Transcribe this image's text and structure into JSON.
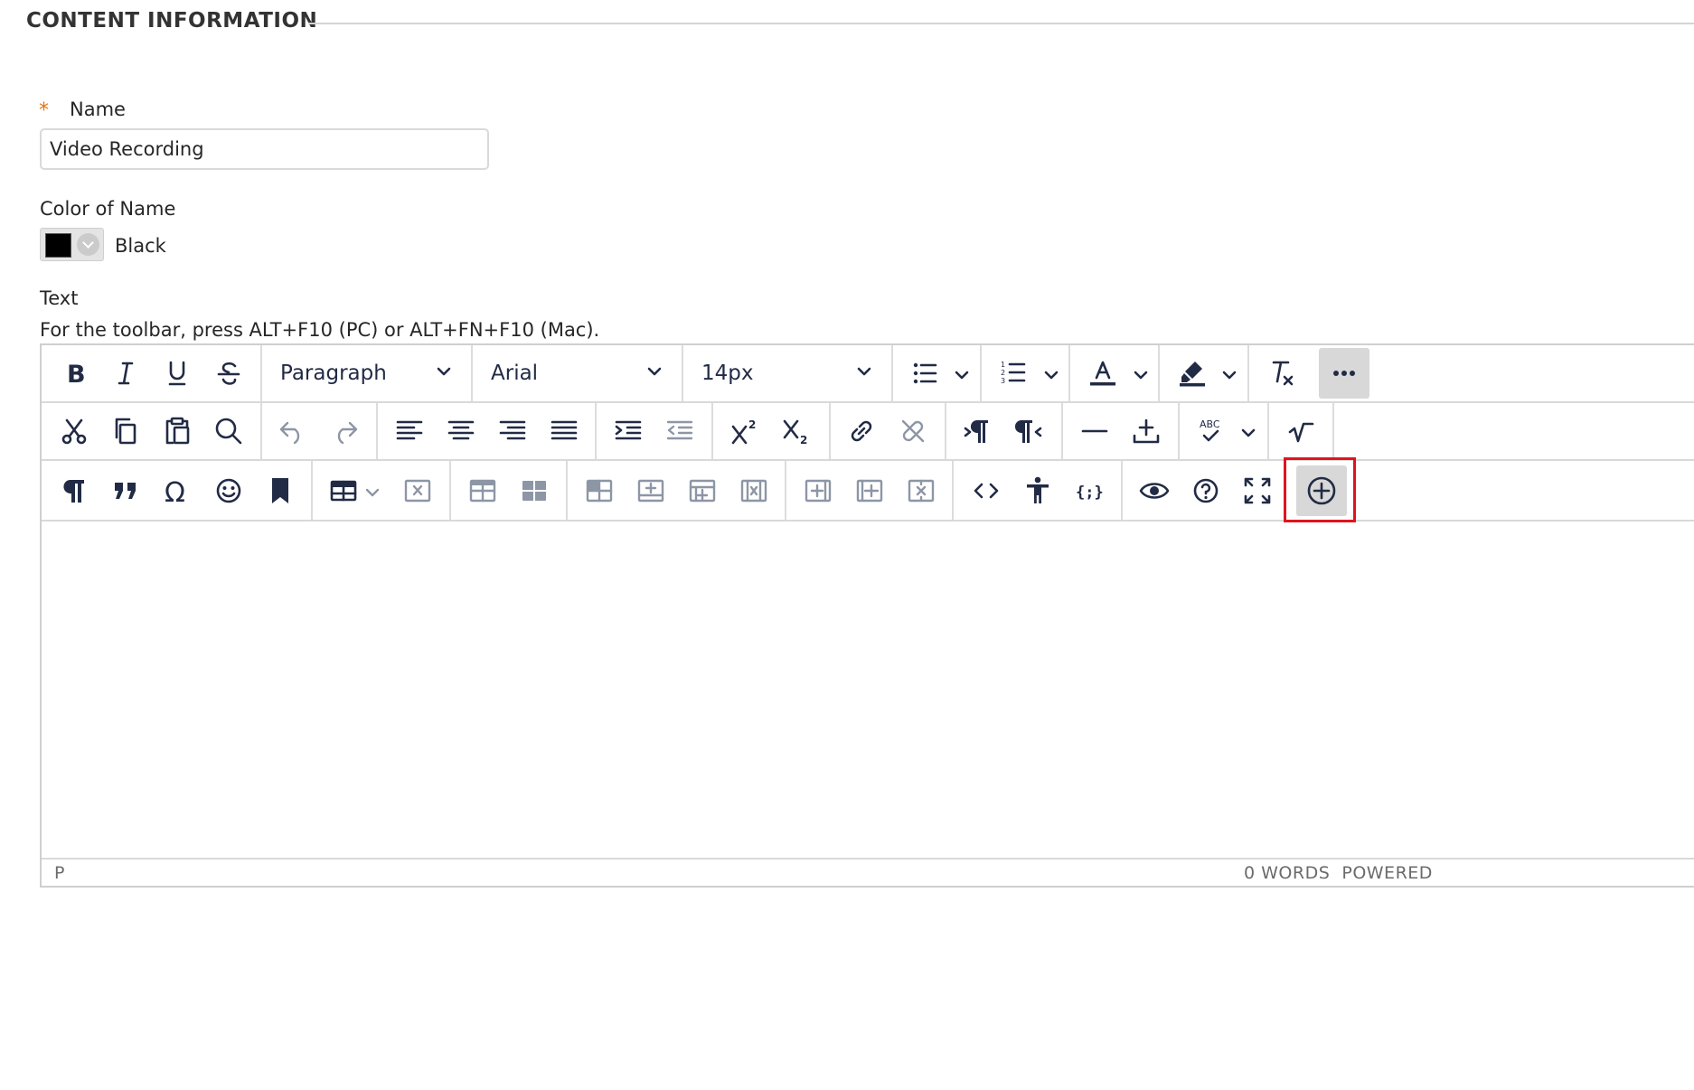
{
  "section": {
    "title": "CONTENT INFORMATION"
  },
  "name_field": {
    "label": "Name",
    "required_mark": "*",
    "value": "Video Recording"
  },
  "color_field": {
    "label": "Color of Name",
    "value": "Black",
    "swatch_color": "#000000"
  },
  "text_field": {
    "label": "Text",
    "hint": "For the toolbar, press ALT+F10 (PC) or ALT+FN+F10 (Mac)."
  },
  "toolbar": {
    "block_format": "Paragraph",
    "font_family": "Arial",
    "font_size": "14px",
    "row1_icons": [
      "bold-icon",
      "italic-icon",
      "underline-icon",
      "strikethrough-icon",
      "bullet-list-icon",
      "numbered-list-icon",
      "text-color-icon",
      "highlight-icon",
      "clear-formatting-icon",
      "more-icon"
    ],
    "row2_icons": [
      "cut-icon",
      "copy-icon",
      "paste-icon",
      "search-icon",
      "undo-icon",
      "redo-icon",
      "align-left-icon",
      "align-center-icon",
      "align-right-icon",
      "align-justify-icon",
      "indent-icon",
      "outdent-icon",
      "superscript-icon",
      "subscript-icon",
      "link-icon",
      "unlink-icon",
      "ltr-icon",
      "rtl-icon",
      "horizontal-rule-icon",
      "insert-file-icon",
      "spellcheck-icon",
      "math-icon"
    ],
    "row3_icons": [
      "paragraph-mark-icon",
      "blockquote-icon",
      "special-char-icon",
      "emoji-icon",
      "bookmark-icon",
      "table-icon",
      "delete-table-icon",
      "table-row-props-icon",
      "table-cell-props-icon",
      "merge-cells-icon",
      "insert-row-before-icon",
      "insert-row-after-icon",
      "delete-row-icon",
      "insert-col-before-icon",
      "insert-col-after-icon",
      "delete-col-icon",
      "source-code-icon",
      "accessibility-icon",
      "code-sample-icon",
      "preview-icon",
      "help-icon",
      "fullscreen-icon",
      "add-content-icon"
    ]
  },
  "status_bar": {
    "path": "P",
    "word_count": "0 WORDS",
    "powered_by": "POWERED"
  },
  "colors": {
    "accent_required": "#e8730c",
    "highlight_border": "#e0141e",
    "icon": "#222b45"
  }
}
